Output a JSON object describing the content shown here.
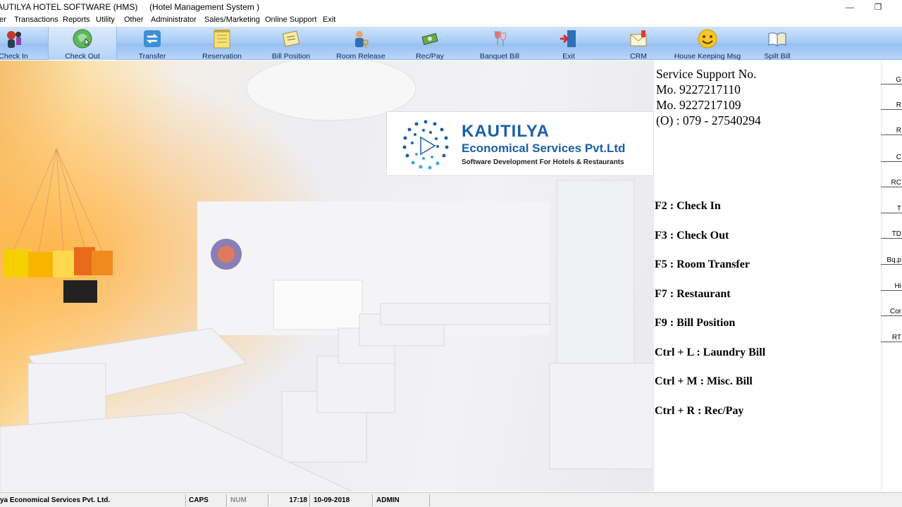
{
  "window": {
    "title": "AUTILYA HOTEL SOFTWARE (HMS)     (Hotel Management System )",
    "minimize": "—",
    "restore": "❐"
  },
  "menu": [
    "er",
    "Transactions",
    "Reports",
    "Utility",
    "Other",
    "Administrator",
    "Sales/Marketing",
    "Online Support",
    "Exit"
  ],
  "toolbar": [
    {
      "label": "Check In",
      "icon": "check-in-icon"
    },
    {
      "label": "Check Out",
      "icon": "check-out-icon"
    },
    {
      "label": "Transfer",
      "icon": "transfer-icon"
    },
    {
      "label": "Reservation",
      "icon": "reservation-icon"
    },
    {
      "label": "Bill Position",
      "icon": "bill-position-icon"
    },
    {
      "label": "Room Release",
      "icon": "room-release-icon"
    },
    {
      "label": "Rec/Pay",
      "icon": "rec-pay-icon"
    },
    {
      "label": "Banquet Bill",
      "icon": "banquet-bill-icon"
    },
    {
      "label": "Exit",
      "icon": "exit-icon"
    },
    {
      "label": "CRM",
      "icon": "crm-icon"
    },
    {
      "label": "House Keeping Msg",
      "icon": "house-keeping-icon"
    },
    {
      "label": "Spilt Bill",
      "icon": "split-bill-icon"
    }
  ],
  "logo": {
    "name": "KAUTILYA",
    "sub": "Economical Services Pvt.Ltd",
    "tag": "Software Development For Hotels & Restaurants"
  },
  "support": {
    "heading": "Service Support No.",
    "lines": [
      "Mo. 9227217110",
      "Mo. 9227217109",
      "(O) : 079 - 27540294"
    ]
  },
  "shortcuts": [
    "F2 : Check In",
    "F3 : Check Out",
    "F5 : Room Transfer",
    "F7 : Restaurant",
    "F9 : Bill Position",
    "Ctrl + L : Laundry Bill",
    "Ctrl + M : Misc. Bill",
    "Ctrl + R : Rec/Pay"
  ],
  "side_buttons": [
    "G",
    "R",
    "R",
    "C",
    "RC",
    "T",
    "TD",
    "Bq.p",
    "Hi",
    "Cor",
    "RT"
  ],
  "statusbar": {
    "company": "ya Economical Services Pvt. Ltd.",
    "caps": "CAPS",
    "num": "NUM",
    "time": "17:18",
    "date": "10-09-2018",
    "user": "ADMIN"
  }
}
